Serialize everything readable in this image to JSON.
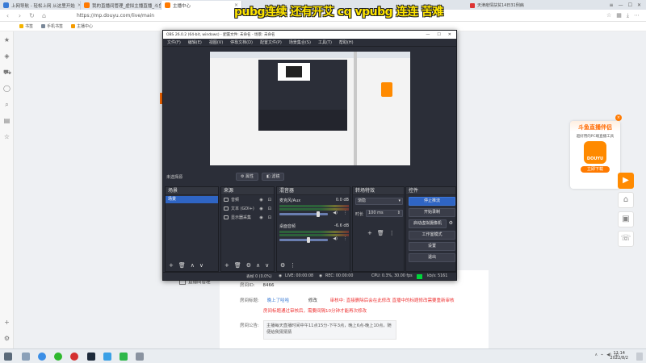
{
  "browser": {
    "tabs": [
      {
        "title": "上网导航 - 轻松上网 从这里开始",
        "active": false
      },
      {
        "title": "我的直播间管理_虚拟主播直播_斗鱼",
        "active": false
      },
      {
        "title": "主播中心",
        "active": true
      }
    ],
    "url": "https://mp.douyu.com/live/main",
    "bookmarks": [
      "书签",
      "手机书签",
      "主播中心"
    ],
    "news": "天津疫情扶贫14日31例病"
  },
  "overlay_title": "pubg连续 还有开艾 cq vpubg 连连 苦难",
  "obs": {
    "title": "OBS 26.0.2 (64-bit, windows) - 配置文件: 未命名 - 场景: 未命名",
    "menu": [
      "文件(F)",
      "编辑(E)",
      "视图(V)",
      "停靠文档(D)",
      "配置文件(P)",
      "场景集合(S)",
      "工具(T)",
      "帮助(H)"
    ],
    "source_bar": {
      "no_source": "未选择源",
      "properties": "属性",
      "filters": "滤镜"
    },
    "scenes": {
      "header": "场景",
      "items": [
        "场景"
      ]
    },
    "sources": {
      "header": "来源",
      "items": [
        {
          "name": "音频",
          "icon": "audio-icon"
        },
        {
          "name": "文本 (GDI+)",
          "icon": "text-icon"
        },
        {
          "name": "显示器采集",
          "icon": "display-icon"
        }
      ]
    },
    "mixer": {
      "header": "混音器",
      "channels": [
        {
          "name": "麦克风/Aux",
          "db": "0.0 dB",
          "level": 0.8
        },
        {
          "name": "桌面音频",
          "db": "-6.6 dB",
          "level": 0.6
        }
      ]
    },
    "transitions": {
      "header": "转场特效",
      "type": "渐隐",
      "duration_label": "时长",
      "duration": "100 ms"
    },
    "controls": {
      "header": "控件",
      "buttons": [
        "停止推流",
        "开始录制",
        "启动虚拟摄像机",
        "工作室模式",
        "设置",
        "退出"
      ]
    },
    "status": {
      "dropped": "丢帧 0 (0.0%)",
      "live": "LIVE: 00:00:08",
      "rec": "REC: 00:00:00",
      "cpu": "CPU: 0.3%, 30.00 fps",
      "kbps": "kb/s: 5161"
    }
  },
  "page": {
    "side_label": "直播间管理",
    "room_id_label": "房间ID:",
    "room_id": "8466",
    "room_title_label": "房间标题:",
    "room_title": "晚上了哈哈",
    "edit": "修改",
    "title_hint": "审核中: 直接删除后会在此修改 直播中的标题修改需要重新审核",
    "title_note": "房间标题通过审核后，需要间隔10分钟才能再次修改",
    "notice_label": "房间公告:",
    "notice": "主播每天直播时间中午11点15分-下午3点，晚上6点-晚上10点，随便给我猜猜猜"
  },
  "promo": {
    "title": "斗鱼直播伴侣",
    "subtitle": "超好用的PC端直播工具",
    "logo": "DOUYU",
    "download": "立即下载"
  },
  "taskbar": {
    "time": "11:14",
    "date": "2022/8/2"
  },
  "colors": {
    "obs_bg": "#2b2e38",
    "obs_accent": "#2f65c4",
    "douyu_orange": "#ff7a00",
    "live_indicator": "#00d43a"
  }
}
